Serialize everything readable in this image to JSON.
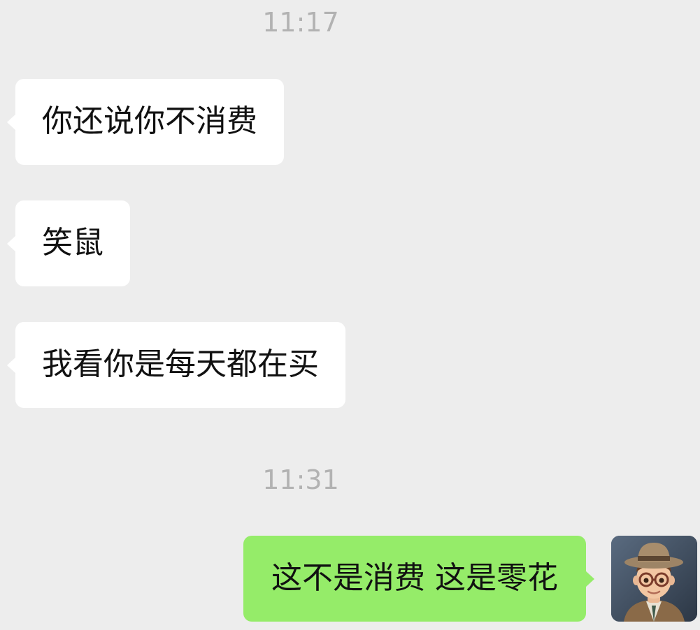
{
  "chat": {
    "timestamps": [
      "11:17",
      "11:31"
    ],
    "incoming": [
      {
        "text": "你还说你不消费"
      },
      {
        "text": "笑鼠"
      },
      {
        "text": "我看你是每天都在买"
      }
    ],
    "outgoing": [
      {
        "text": "这不是消费 这是零花"
      }
    ]
  },
  "colors": {
    "background": "#ededed",
    "incoming_bubble": "#ffffff",
    "outgoing_bubble": "#95ec69",
    "timestamp_text": "#b2b2b2",
    "message_text": "#111111"
  },
  "icons": {
    "avatar": "user-avatar-cartoon-man-with-hat-and-glasses"
  }
}
